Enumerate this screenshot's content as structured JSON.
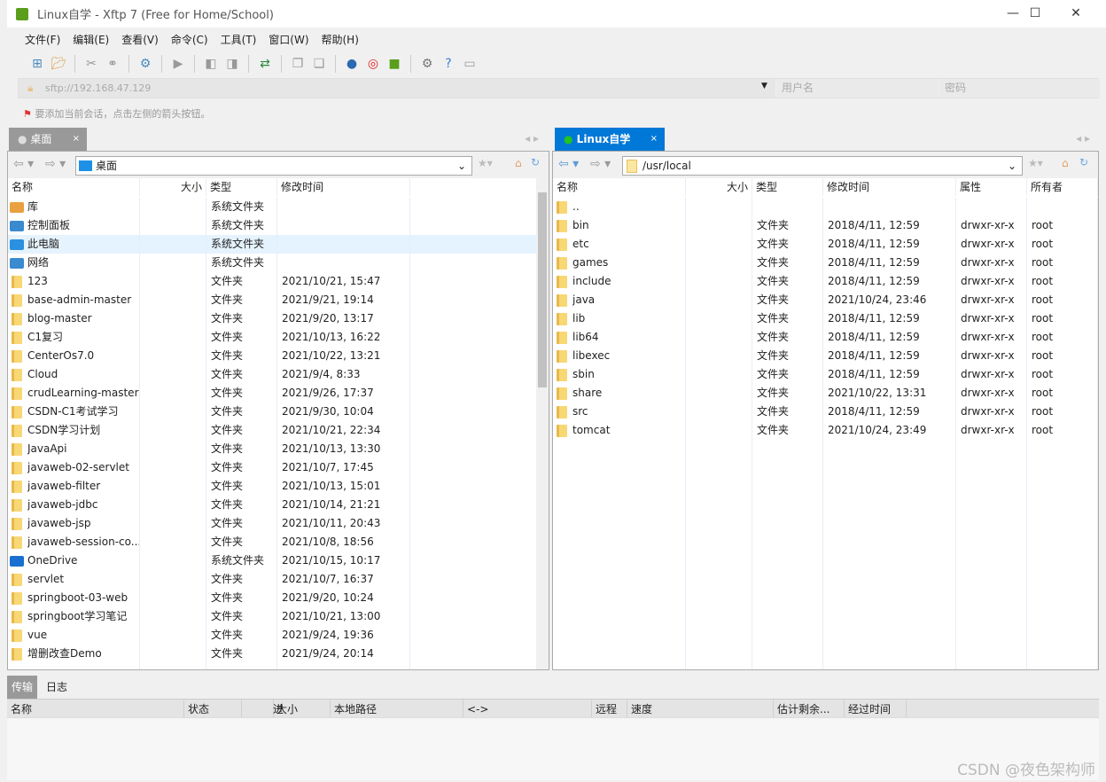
{
  "window": {
    "title": "Linux自学 - Xftp 7 (Free for Home/School)",
    "min": "—",
    "max": "☐",
    "close": "✕"
  },
  "menu": [
    "文件(F)",
    "编辑(E)",
    "查看(V)",
    "命令(C)",
    "工具(T)",
    "窗口(W)",
    "帮助(H)"
  ],
  "toolbar_icons": [
    "new-session-icon",
    "open-folder-icon",
    "disconnect-icon",
    "reconnect-icon",
    "new-window-icon",
    "terminal-icon",
    "copy-left-icon",
    "copy-right-icon",
    "sync-icon",
    "copy-icon",
    "paste-icon",
    "globe-icon",
    "xshell-icon",
    "xftp-icon",
    "gear-icon",
    "help-icon",
    "chat-icon"
  ],
  "address": {
    "url": "sftp://192.168.47.129",
    "user_placeholder": "用户名",
    "password_placeholder": "密码"
  },
  "hint": "要添加当前会话，点击左侧的箭头按钮。",
  "left": {
    "tab": "桌面",
    "path": "桌面",
    "columns": [
      "名称",
      "大小",
      "类型",
      "修改时间"
    ],
    "rows": [
      [
        "库",
        "",
        "系统文件夹",
        "",
        "lib"
      ],
      [
        "控制面板",
        "",
        "系统文件夹",
        "",
        "ctrl"
      ],
      [
        "此电脑",
        "",
        "系统文件夹",
        "",
        "pc"
      ],
      [
        "网络",
        "",
        "系统文件夹",
        "",
        "net"
      ],
      [
        "123",
        "",
        "文件夹",
        "2021/10/21, 15:47"
      ],
      [
        "base-admin-master",
        "",
        "文件夹",
        "2021/9/21, 19:14"
      ],
      [
        "blog-master",
        "",
        "文件夹",
        "2021/9/20, 13:17"
      ],
      [
        "C1复习",
        "",
        "文件夹",
        "2021/10/13, 16:22"
      ],
      [
        "CenterOs7.0",
        "",
        "文件夹",
        "2021/10/22, 13:21"
      ],
      [
        "Cloud",
        "",
        "文件夹",
        "2021/9/4, 8:33"
      ],
      [
        "crudLearning-master",
        "",
        "文件夹",
        "2021/9/26, 17:37"
      ],
      [
        "CSDN-C1考试学习",
        "",
        "文件夹",
        "2021/9/30, 10:04"
      ],
      [
        "CSDN学习计划",
        "",
        "文件夹",
        "2021/10/21, 22:34"
      ],
      [
        "JavaApi",
        "",
        "文件夹",
        "2021/10/13, 13:30"
      ],
      [
        "javaweb-02-servlet",
        "",
        "文件夹",
        "2021/10/7, 17:45"
      ],
      [
        "javaweb-filter",
        "",
        "文件夹",
        "2021/10/13, 15:01"
      ],
      [
        "javaweb-jdbc",
        "",
        "文件夹",
        "2021/10/14, 21:21"
      ],
      [
        "javaweb-jsp",
        "",
        "文件夹",
        "2021/10/11, 20:43"
      ],
      [
        "javaweb-session-co...",
        "",
        "文件夹",
        "2021/10/8, 18:56"
      ],
      [
        "OneDrive",
        "",
        "系统文件夹",
        "2021/10/15, 10:17",
        "cloud"
      ],
      [
        "servlet",
        "",
        "文件夹",
        "2021/10/7, 16:37"
      ],
      [
        "springboot-03-web",
        "",
        "文件夹",
        "2021/9/20, 10:24"
      ],
      [
        "springboot学习笔记",
        "",
        "文件夹",
        "2021/10/21, 13:00"
      ],
      [
        "vue",
        "",
        "文件夹",
        "2021/9/24, 19:36"
      ],
      [
        "增删改查Demo",
        "",
        "文件夹",
        "2021/9/24, 20:14"
      ]
    ]
  },
  "right": {
    "tab": "Linux自学",
    "path": "/usr/local",
    "columns": [
      "名称",
      "大小",
      "类型",
      "修改时间",
      "属性",
      "所有者"
    ],
    "rows": [
      [
        "..",
        "",
        "",
        "",
        "",
        ""
      ],
      [
        "bin",
        "",
        "文件夹",
        "2018/4/11, 12:59",
        "drwxr-xr-x",
        "root"
      ],
      [
        "etc",
        "",
        "文件夹",
        "2018/4/11, 12:59",
        "drwxr-xr-x",
        "root"
      ],
      [
        "games",
        "",
        "文件夹",
        "2018/4/11, 12:59",
        "drwxr-xr-x",
        "root"
      ],
      [
        "include",
        "",
        "文件夹",
        "2018/4/11, 12:59",
        "drwxr-xr-x",
        "root"
      ],
      [
        "java",
        "",
        "文件夹",
        "2021/10/24, 23:46",
        "drwxr-xr-x",
        "root"
      ],
      [
        "lib",
        "",
        "文件夹",
        "2018/4/11, 12:59",
        "drwxr-xr-x",
        "root"
      ],
      [
        "lib64",
        "",
        "文件夹",
        "2018/4/11, 12:59",
        "drwxr-xr-x",
        "root"
      ],
      [
        "libexec",
        "",
        "文件夹",
        "2018/4/11, 12:59",
        "drwxr-xr-x",
        "root"
      ],
      [
        "sbin",
        "",
        "文件夹",
        "2018/4/11, 12:59",
        "drwxr-xr-x",
        "root"
      ],
      [
        "share",
        "",
        "文件夹",
        "2021/10/22, 13:31",
        "drwxr-xr-x",
        "root"
      ],
      [
        "src",
        "",
        "文件夹",
        "2018/4/11, 12:59",
        "drwxr-xr-x",
        "root"
      ],
      [
        "tomcat",
        "",
        "文件夹",
        "2021/10/24, 23:49",
        "drwxr-xr-x",
        "root"
      ]
    ]
  },
  "bottom": {
    "tabs": [
      "传输",
      "日志"
    ],
    "columns": [
      "名称",
      "状态",
      "进度",
      "大小",
      "本地路径",
      "<->",
      "远程路径",
      "速度",
      "估计剩余...",
      "经过时间"
    ]
  },
  "watermark": "CSDN @夜色架构师",
  "colors": {
    "accent": "#0078d7",
    "connected": "#22c322"
  }
}
